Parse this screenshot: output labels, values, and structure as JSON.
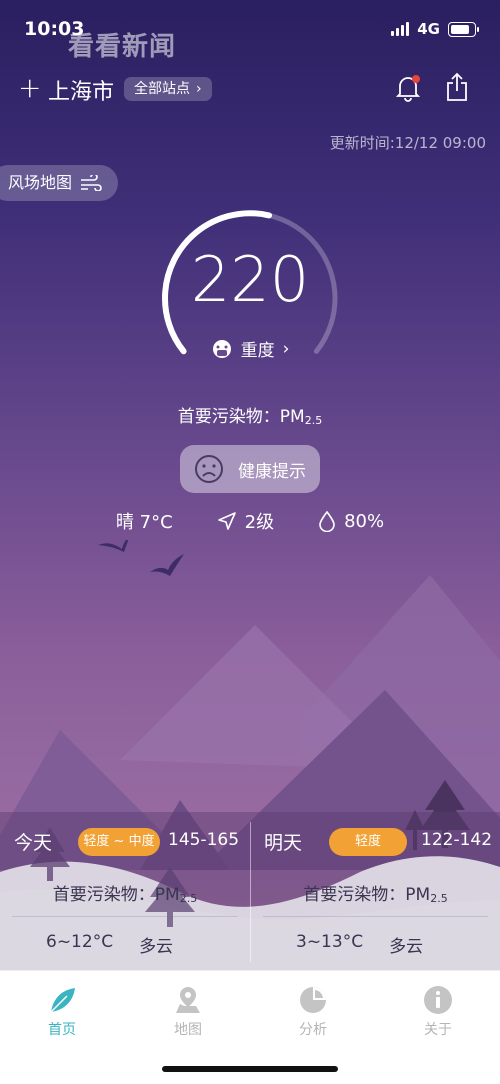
{
  "status": {
    "time": "10:03",
    "network": "4G"
  },
  "watermark": "看看新闻",
  "header": {
    "city": "上海市",
    "station_button": "全部站点"
  },
  "update_time": "更新时间:12/12 09:00",
  "wind_map_label": "风场地图",
  "aqi": {
    "value": "220",
    "level": "重度",
    "gauge_fraction": 0.55,
    "gauge_color": "#ffffff"
  },
  "pollutant": {
    "prefix": "首要污染物：",
    "name": "PM",
    "sub": "2.5"
  },
  "health_button": "健康提示",
  "weather": {
    "condition": "晴 7°C",
    "wind": "2级",
    "humidity": "80%"
  },
  "forecast": {
    "today": {
      "day": "今天",
      "badge": "轻度 ~ 中度",
      "range": "145-165",
      "pollutant_prefix": "首要污染物：",
      "pollutant_name": "PM",
      "pollutant_sub": "2.5",
      "temp": "6~12°C",
      "weather": "多云"
    },
    "tomorrow": {
      "day": "明天",
      "badge": "轻度",
      "range": "122-142",
      "pollutant_prefix": "首要污染物：",
      "pollutant_name": "PM",
      "pollutant_sub": "2.5",
      "temp": "3~13°C",
      "weather": "多云"
    }
  },
  "badge_color": "#f2a134",
  "tabs": [
    {
      "label": "首页",
      "icon": "leaf-icon",
      "active": true
    },
    {
      "label": "地图",
      "icon": "map-pin-icon",
      "active": false
    },
    {
      "label": "分析",
      "icon": "pie-chart-icon",
      "active": false
    },
    {
      "label": "关于",
      "icon": "info-icon",
      "active": false
    }
  ]
}
